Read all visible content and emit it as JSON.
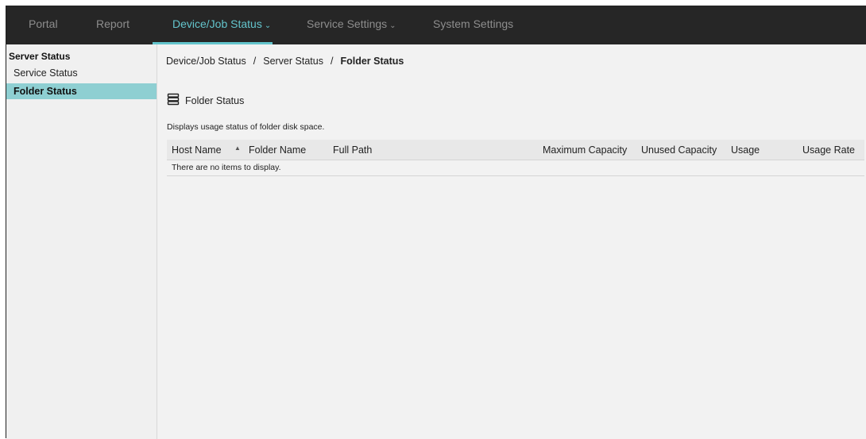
{
  "topnav": {
    "items": [
      {
        "label": "Portal",
        "has_caret": false
      },
      {
        "label": "Report",
        "has_caret": false
      },
      {
        "label": "Device/Job Status",
        "has_caret": true
      },
      {
        "label": "Service Settings",
        "has_caret": true
      },
      {
        "label": "System Settings",
        "has_caret": false
      }
    ],
    "active_index": 2,
    "caret_glyph": "⌄"
  },
  "sidebar": {
    "group_label": "Server Status",
    "items": [
      {
        "label": "Service Status",
        "selected": false
      },
      {
        "label": "Folder Status",
        "selected": true
      }
    ]
  },
  "breadcrumb": {
    "items": [
      "Device/Job Status",
      "Server Status",
      "Folder Status"
    ],
    "separator": "/"
  },
  "section": {
    "title": "Folder Status",
    "icon": "server-stack-icon",
    "description": "Displays usage status of folder disk space."
  },
  "table": {
    "columns": [
      {
        "label": "Host Name",
        "sorted": "ascending"
      },
      {
        "label": "Folder Name"
      },
      {
        "label": "Full Path"
      },
      {
        "label": "Maximum Capacity"
      },
      {
        "label": "Unused Capacity"
      },
      {
        "label": "Usage"
      },
      {
        "label": "Usage Rate"
      }
    ],
    "sort_glyph": "▲",
    "rows": [],
    "empty_message": "There are no items to display."
  },
  "colors": {
    "nav_background": "#262626",
    "accent": "#63c4cc",
    "selected_background": "#8ecfd2",
    "content_background": "#f2f2f2"
  }
}
